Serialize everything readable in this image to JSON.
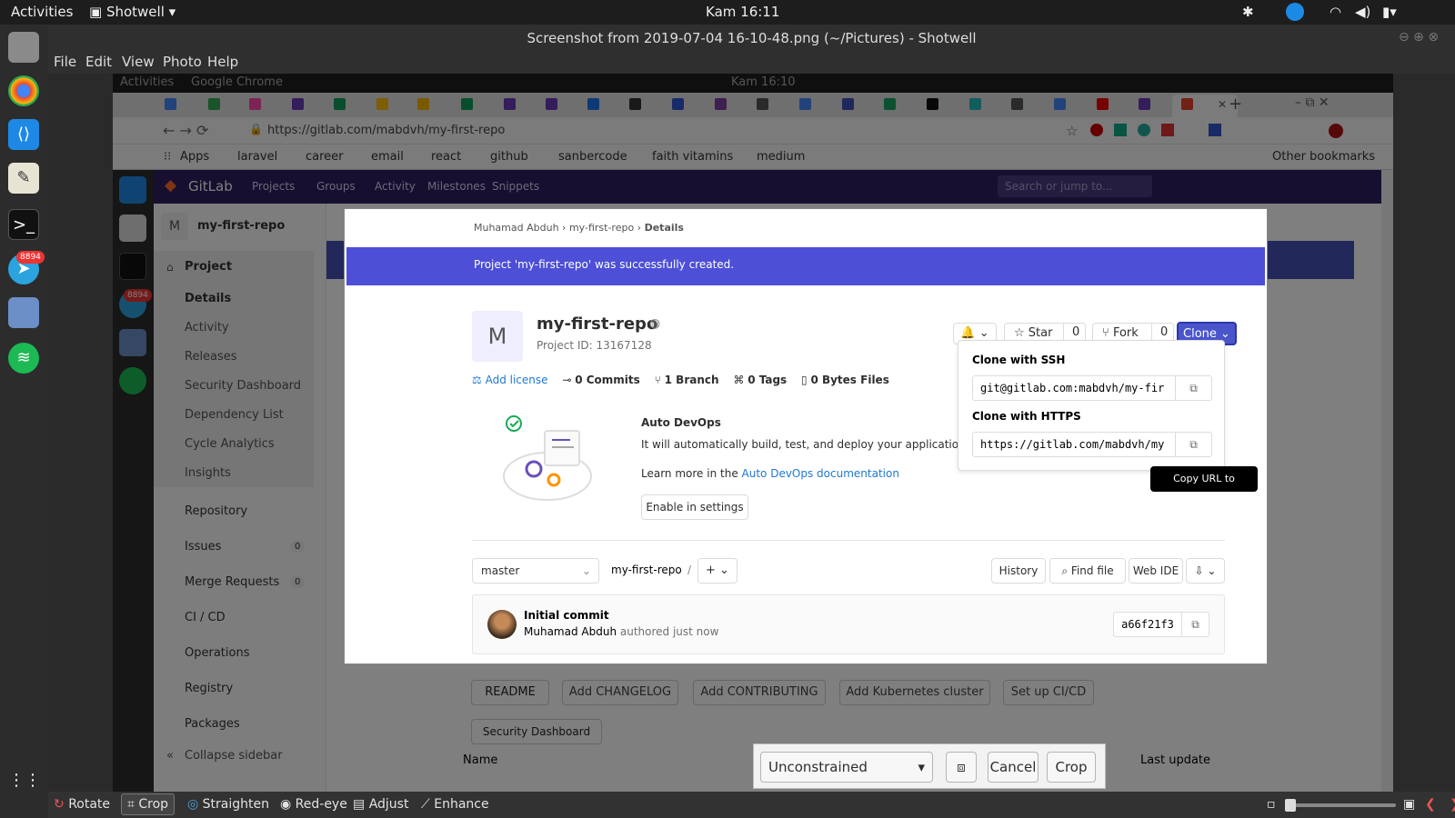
{
  "topbar": {
    "activities": "Activities",
    "app": "Shotwell",
    "clock": "Kam 16:11"
  },
  "window": {
    "title": "Screenshot from 2019-07-04 16-10-48.png (~/Pictures) - Shotwell"
  },
  "menu": {
    "file": "File",
    "edit": "Edit",
    "view": "View",
    "photo": "Photo",
    "help": "Help"
  },
  "dock": {
    "telegram_badge": "8894"
  },
  "inner": {
    "activities": "Activities",
    "app": "Google Chrome",
    "clock": "Kam 16:10",
    "url": "https://gitlab.com/mabdvh/my-first-repo",
    "bookmarks": [
      "Apps",
      "laravel",
      "career",
      "email",
      "react",
      "github",
      "sanbercode",
      "faith vitamins",
      "medium"
    ],
    "other_bookmarks": "Other bookmarks",
    "badge": "8894"
  },
  "gitlab": {
    "logo": "GitLab",
    "nav": [
      "Projects",
      "Groups",
      "Activity",
      "Milestones",
      "Snippets"
    ],
    "search_placeholder": "Search or jump to...",
    "sidebar": {
      "repo_initial": "M",
      "repo_name": "my-first-repo",
      "project": "Project",
      "items": [
        "Details",
        "Activity",
        "Releases",
        "Security Dashboard",
        "Dependency List",
        "Cycle Analytics",
        "Insights"
      ],
      "repository": "Repository",
      "issues": "Issues",
      "issues_count": "0",
      "merge_requests": "Merge Requests",
      "mr_count": "0",
      "cicd": "CI / CD",
      "operations": "Operations",
      "registry": "Registry",
      "packages": "Packages",
      "collapse": "Collapse sidebar"
    },
    "breadcrumb": {
      "user": "Muhamad Abduh",
      "repo": "my-first-repo",
      "current": "Details"
    },
    "flash": "Project 'my-first-repo' was successfully created.",
    "project": {
      "initial": "M",
      "name": "my-first-repo",
      "id": "Project ID: 13167128",
      "star": "Star",
      "star_count": "0",
      "fork": "Fork",
      "fork_count": "0",
      "clone": "Clone",
      "add_license": "Add license",
      "commits": "0 Commits",
      "branch": "1 Branch",
      "tags": "0 Tags",
      "files": "0 Bytes Files"
    },
    "clone_dropdown": {
      "ssh_title": "Clone with SSH",
      "ssh_url": "git@gitlab.com:mabdvh/my-fir",
      "https_title": "Clone with HTTPS",
      "https_url": "https://gitlab.com/mabdvh/my",
      "tooltip": "Copy URL to clipboard"
    },
    "devops": {
      "title": "Auto DevOps",
      "text": "It will automatically build, test, and deploy your application base",
      "learn": "Learn more in the",
      "link": "Auto DevOps documentation",
      "enable": "Enable in settings"
    },
    "repo_bar": {
      "branch": "master",
      "path": "my-first-repo",
      "sep": "/",
      "history": "History",
      "find": "Find file",
      "webide": "Web IDE"
    },
    "commit": {
      "title": "Initial commit",
      "author": "Muhamad Abduh",
      "when": "authored just now",
      "sha": "a66f21f3"
    },
    "bottom_buttons": [
      "README",
      "Add CHANGELOG",
      "Add CONTRIBUTING",
      "Add Kubernetes cluster",
      "Set up CI/CD"
    ],
    "security_dashboard": "Security Dashboard",
    "table": {
      "name": "Name",
      "last_update": "Last update"
    }
  },
  "crop_tool": {
    "ratio": "Unconstrained",
    "cancel": "Cancel",
    "crop": "Crop"
  },
  "toolbar": {
    "rotate": "Rotate",
    "crop": "Crop",
    "straighten": "Straighten",
    "redeye": "Red-eye",
    "adjust": "Adjust",
    "enhance": "Enhance"
  }
}
